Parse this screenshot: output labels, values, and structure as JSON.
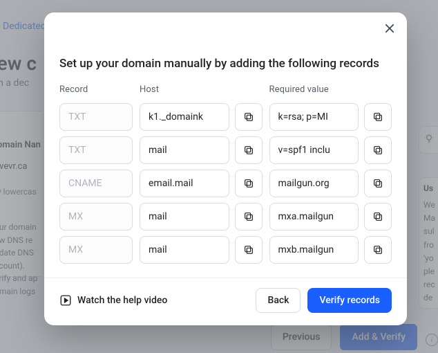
{
  "background": {
    "top_link_fragment": "Dedicated",
    "heading_fragment": "new c",
    "subheading_fragment": "rom a dec",
    "domain_label_fragment": "omain Nan",
    "domain_value_fragment": "ivevr.ca",
    "hint_fragment": "y lowercas",
    "para_lines": [
      "our domain",
      "ew DNS re",
      "pdate DNS",
      "ccount).",
      "erify and ap",
      "omain logs"
    ],
    "right_panel_head": "Us",
    "right_panel_lines": [
      "We",
      "Ma",
      "sul",
      "fro",
      "'yo",
      "ple",
      "rec",
      "de"
    ],
    "prev_label": "Previous",
    "add_verify_label": "Add & Verify"
  },
  "modal": {
    "title": "Set up your domain manually by adding the following records",
    "headers": {
      "record": "Record",
      "host": "Host",
      "value": "Required value"
    },
    "rows": [
      {
        "record": "TXT",
        "host": "k1._domaink",
        "value": "k=rsa; p=MI"
      },
      {
        "record": "TXT",
        "host": "mail",
        "value": "v=spf1 inclu"
      },
      {
        "record": "CNAME",
        "host": "email.mail",
        "value": "mailgun.org"
      },
      {
        "record": "MX",
        "host": "mail",
        "value": "mxa.mailgun"
      },
      {
        "record": "MX",
        "host": "mail",
        "value": "mxb.mailgun"
      }
    ],
    "help_label": "Watch the help video",
    "back_label": "Back",
    "verify_label": "Verify records"
  }
}
